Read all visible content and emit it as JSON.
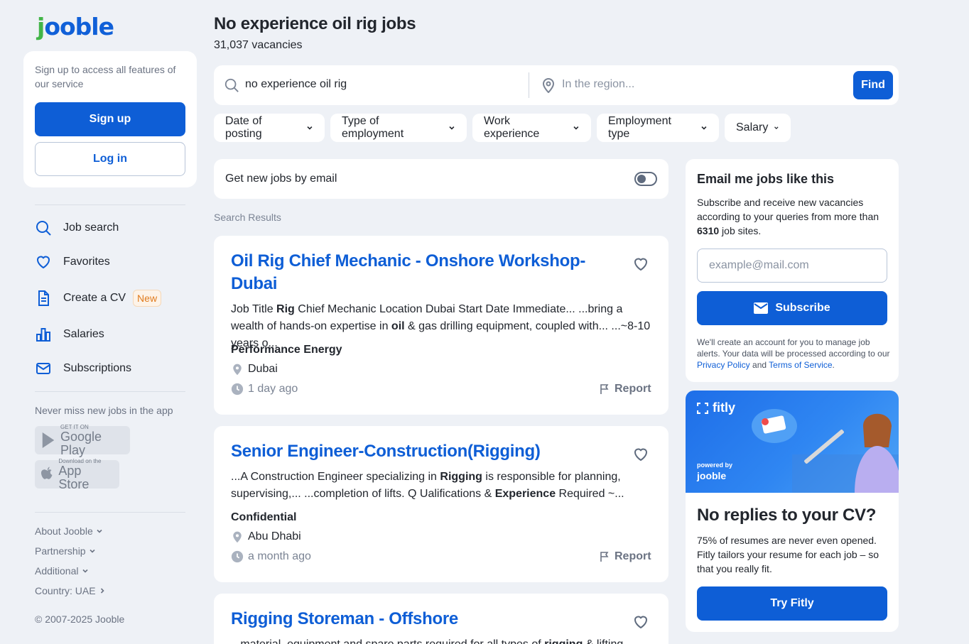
{
  "brand": {
    "logo_j": "j",
    "logo_rest": "ooble"
  },
  "sidebar": {
    "signup_prompt": "Sign up to access all features of our service",
    "signup_label": "Sign up",
    "login_label": "Log in",
    "nav": [
      {
        "label": "Job search",
        "icon": "search-icon"
      },
      {
        "label": "Favorites",
        "icon": "heart-icon"
      },
      {
        "label": "Create a CV",
        "icon": "document-icon",
        "badge": "New"
      },
      {
        "label": "Salaries",
        "icon": "bar-chart-icon"
      },
      {
        "label": "Subscriptions",
        "icon": "mail-icon"
      }
    ],
    "app_prompt": "Never miss new jobs in the app",
    "google_play": {
      "small": "GET IT ON",
      "big": "Google Play"
    },
    "app_store": {
      "small": "Download on the",
      "big": "App Store"
    },
    "footer_links": [
      "About Jooble",
      "Partnership",
      "Additional",
      "Country: UAE"
    ],
    "copyright": "© 2007-2025 Jooble"
  },
  "header": {
    "title": "No experience oil rig jobs",
    "vacancies": "31,037 vacancies"
  },
  "search": {
    "keyword_value": "no experience oil rig",
    "region_placeholder": "In the region...",
    "find_label": "Find"
  },
  "filters": [
    "Date of posting",
    "Type of employment",
    "Work experience",
    "Employment type",
    "Salary"
  ],
  "email_toggle": {
    "label": "Get new jobs by email",
    "on": false
  },
  "results_label": "Search Results",
  "jobs": [
    {
      "title": "Oil Rig Chief Mechanic - Onshore Workshop- Dubai",
      "desc_parts": [
        "Job Title ",
        "Rig",
        " Chief Mechanic Location Dubai Start Date Immediate...  ...bring a wealth of hands-on expertise in ",
        "oil",
        " & gas drilling equipment, coupled with...  ...~8-10 years o..."
      ],
      "company": "Performance Energy",
      "location": "Dubai",
      "posted": "1 day ago",
      "report": "Report"
    },
    {
      "title": "Senior Engineer-Construction(Rigging)",
      "desc_parts": [
        " ...A Construction Engineer specializing in ",
        "Rigging",
        " is responsible for planning, supervising,...  ...completion of lifts. Q Ualifications & ",
        "Experience",
        " Required ~..."
      ],
      "company": "Confidential",
      "location": "Abu Dhabi",
      "posted": "a month ago",
      "report": "Report"
    },
    {
      "title": "Rigging Storeman - Offshore",
      "desc_parts": [
        "...material, equipment and spare parts required for all types of ",
        "rigging",
        " & lifting..."
      ]
    }
  ],
  "subscribe": {
    "title": "Email me jobs like this",
    "text_before": "Subscribe and receive new vacancies according to your queries from more than ",
    "sites_count": "6310",
    "text_after": " job sites.",
    "email_placeholder": "example@mail.com",
    "button_label": "Subscribe",
    "legal_before": "We'll create an account for you to manage job alerts. Your data will be processed according to our ",
    "privacy_link": "Privacy Policy",
    "legal_and": " and ",
    "terms_link": "Terms of Service",
    "legal_end": "."
  },
  "fitly": {
    "brand": "fitly",
    "powered_by": "powered by",
    "powered_logo": "jooble",
    "title": "No replies to your CV?",
    "text": "75% of resumes are never even opened. Fitly tailors your resume for each job – so that you really fit.",
    "button_label": "Try Fitly"
  },
  "colors": {
    "accent": "#0e5ed6",
    "logo_green": "#42b548",
    "background": "#eef1f6"
  }
}
